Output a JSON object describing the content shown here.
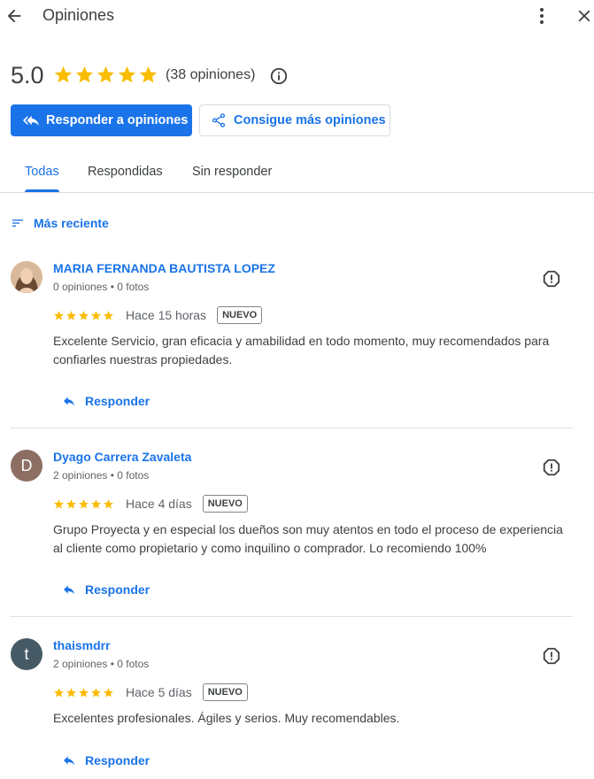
{
  "header": {
    "title": "Opiniones",
    "back_icon": "arrow-left-icon",
    "more_icon": "more-vert-icon",
    "close_icon": "close-icon"
  },
  "summary": {
    "rating": "5.0",
    "stars": 5,
    "count_label": "(38 opiniones)",
    "info_icon": "info-icon"
  },
  "actions": {
    "reply_label": "Responder a opiniones",
    "get_more_label": "Consigue más opiniones"
  },
  "tabs": [
    {
      "label": "Todas",
      "active": true
    },
    {
      "label": "Respondidas",
      "active": false
    },
    {
      "label": "Sin responder",
      "active": false
    }
  ],
  "sort": {
    "label": "Más reciente"
  },
  "reviews": [
    {
      "name": "MARIA FERNANDA BAUTISTA LOPEZ",
      "meta": "0 opiniones • 0 fotos",
      "avatar_type": "photo",
      "stars": 5,
      "time": "Hace 15 horas",
      "badge": "NUEVO",
      "text": "Excelente Servicio, gran eficacia y amabilidad en todo momento, muy recomendados para confiarles nuestras propiedades.",
      "reply_label": "Responder"
    },
    {
      "name": "Dyago Carrera Zavaleta",
      "meta": "2 opiniones • 0 fotos",
      "avatar_letter": "D",
      "avatar_color": "#8d6e63",
      "stars": 5,
      "time": "Hace 4 días",
      "badge": "NUEVO",
      "text": "Grupo Proyecta y en especial los dueños son muy atentos en todo el proceso de experiencia al cliente como propietario y como inquilino o comprador. Lo recomiendo 100%",
      "reply_label": "Responder"
    },
    {
      "name": "thaismdrr",
      "meta": "2 opiniones • 0 fotos",
      "avatar_letter": "t",
      "avatar_color": "#455a64",
      "stars": 5,
      "time": "Hace 5 días",
      "badge": "NUEVO",
      "text": "Excelentes profesionales. Ágiles y serios. Muy recomendables.",
      "reply_label": "Responder"
    }
  ],
  "colors": {
    "accent": "#1a73e8",
    "star": "#fbbc04"
  }
}
